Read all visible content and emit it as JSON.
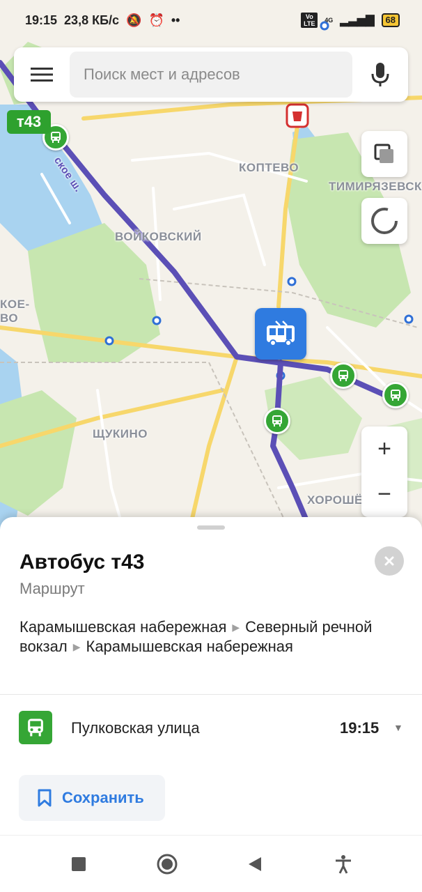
{
  "status_bar": {
    "time": "19:15",
    "speed": "23,8 КБ/с",
    "network": "4G",
    "volte": "Vo LTE",
    "battery": "68"
  },
  "search": {
    "placeholder": "Поиск мест и адресов"
  },
  "map": {
    "route_badge": "т43",
    "districts": [
      "КОПТЕВО",
      "ТИМИРЯЗЕВСК",
      "ВОЙКОВСКИЙ",
      "ЩУКИНО",
      "ХОРОШЁВСКИЙ",
      "КОЕ-",
      "ВО"
    ],
    "road_label": "ское ш.",
    "colors": {
      "route": "#5b4fb6",
      "stop": "#35a635",
      "bus_marker": "#2f7be0",
      "park": "#c7e6b0",
      "water": "#a9d3f0",
      "road": "#f7d76b"
    }
  },
  "sheet": {
    "title": "Автобус т43",
    "subtitle": "Маршрут",
    "route": {
      "from": "Карамышевская набережная",
      "via": "Северный речной вокзал",
      "to": "Карамышевская набережная"
    },
    "stop": {
      "name": "Пулковская улица",
      "time": "19:15"
    },
    "save_label": "Сохранить"
  }
}
